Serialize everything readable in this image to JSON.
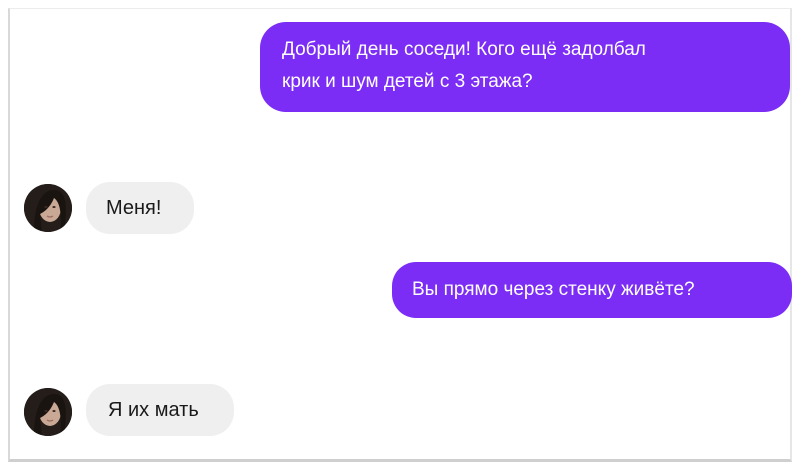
{
  "chat": {
    "messages": [
      {
        "side": "outgoing",
        "lines": [
          "Добрый день соседи! Кого ещё задолбал",
          "крик и шум детей с 3 этажа?"
        ]
      },
      {
        "side": "incoming",
        "text": "Меня!"
      },
      {
        "side": "outgoing",
        "text": "Вы прямо через стенку живёте?"
      },
      {
        "side": "incoming",
        "text": "Я их мать"
      }
    ]
  },
  "colors": {
    "outgoing_bubble": "#7b2cf5",
    "incoming_bubble": "#efefef",
    "outgoing_text": "#ffffff",
    "incoming_text": "#1a1a1a"
  },
  "icons": {
    "avatar": "user-photo-avatar"
  }
}
